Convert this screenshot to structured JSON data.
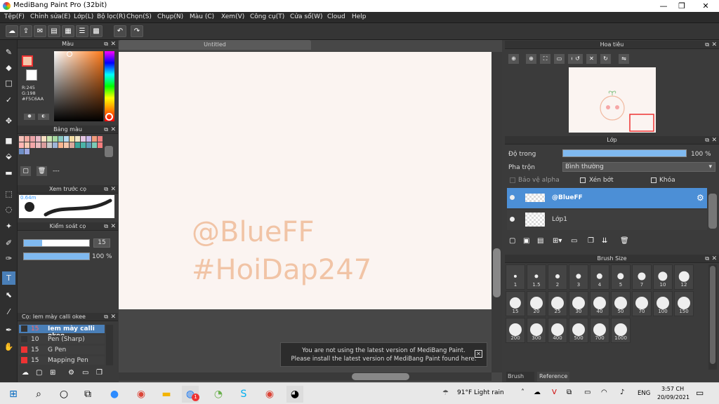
{
  "window": {
    "title": "MediBang Paint Pro (32bit)",
    "minimize": "—",
    "maximize": "❐",
    "close": "✕"
  },
  "menu": [
    "Tệp(F)",
    "Chỉnh sửa(E)",
    "Lớp(L)",
    "Bộ lọc(R)",
    "Chọn(S)",
    "Chụp(N)",
    "Màu (C)",
    "Xem(V)",
    "Công cụ(T)",
    "Cửa sổ(W)",
    "Cloud",
    "Help"
  ],
  "color_panel": {
    "title": "Màu",
    "r": "R:245",
    "g": "G:198",
    "b": "B:170",
    "hex": "#F5C6AA",
    "fg_color": "#F5C6AA",
    "bg_color": "#FFFFFF"
  },
  "palette_panel": {
    "title": "Bảng màu",
    "name": "---",
    "colors": [
      "#f6c0b8",
      "#f3a9a0",
      "#eaa3a7",
      "#e9b9c6",
      "#f7dcbf",
      "#c9e6b1",
      "#a6d8a0",
      "#88c9c2",
      "#b5d9ef",
      "#f4dda2",
      "#f2e6c8",
      "#e6c6e3",
      "#c6b6ea",
      "#f19c7c",
      "#f08080",
      "#ffb6b3",
      "#f9c8b0",
      "#f4a6a8",
      "#ebbbbf",
      "#d99c9c",
      "#c8c8c8",
      "#9eb4d6",
      "#f8b48d",
      "#f5c6aa",
      "#dba79c",
      "#3aa59a",
      "#4bb3a7",
      "#5d9bb9",
      "#7ccab5",
      "#f47d7d",
      "#6f8fc6",
      "#9aa6e0"
    ]
  },
  "brush_preview": {
    "title": "Xem trước cọ",
    "size": "0.64m"
  },
  "brush_control": {
    "title": "Kiểm soát cọ",
    "size": "15",
    "opacity": "100 %"
  },
  "brush_list": {
    "title": "Cọ: Iem mày calli okee",
    "items": [
      {
        "size": "15",
        "name": "Iem mày calli okee",
        "color": "#333"
      },
      {
        "size": "10",
        "name": "Pen (Sharp)",
        "color": "#333"
      },
      {
        "size": "15",
        "name": "G Pen",
        "color": "#e33"
      },
      {
        "size": "15",
        "name": "Mapping Pen",
        "color": "#e33"
      }
    ]
  },
  "document": {
    "tab": "Untitled",
    "watermark1": "@BlueFF",
    "watermark2": "#HoiDap247"
  },
  "notification": {
    "line1": "You are not using the latest version of MediBang Paint.",
    "line2": "Please install the latest version of MediBang Paint found here.",
    "close": "✕"
  },
  "navigator": {
    "title": "Hoa tiêu"
  },
  "layer_panel": {
    "title": "Lớp",
    "opacity_label": "Độ trong",
    "opacity_value": "100 %",
    "blend_label": "Pha trộn",
    "blend_value": "Bình thường",
    "protect_alpha": "Bảo vệ alpha",
    "clipping": "Xén bớt",
    "lock": "Khóa",
    "layers": [
      "@BlueFF",
      "Lớp1"
    ]
  },
  "brush_size": {
    "title": "Brush Size",
    "sizes": [
      "1",
      "1.5",
      "2",
      "3",
      "4",
      "5",
      "7",
      "10",
      "12",
      "15",
      "20",
      "25",
      "30",
      "40",
      "50",
      "70",
      "100",
      "150",
      "200",
      "300",
      "400",
      "500",
      "700",
      "1000"
    ],
    "tabs": [
      "Brush Size",
      "Reference"
    ]
  },
  "taskbar": {
    "weather": "91°F  Light rain",
    "lang": "ENG",
    "time": "3:57 CH",
    "date": "20/09/2021",
    "badge": "1"
  }
}
